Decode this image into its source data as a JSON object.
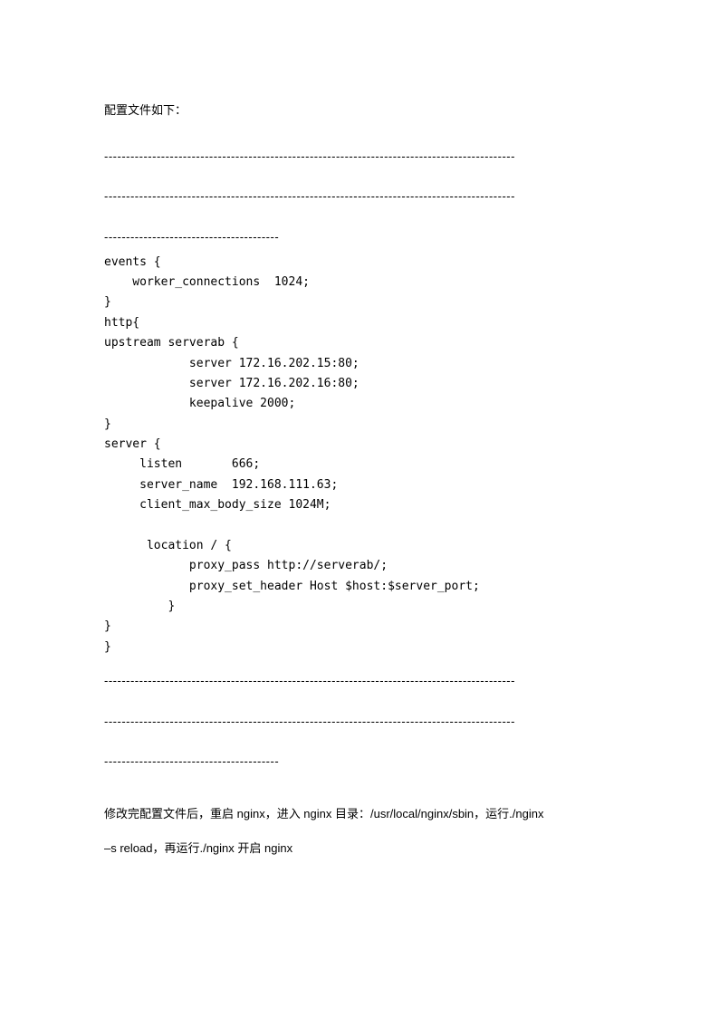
{
  "heading": "配置文件如下：",
  "divider_long": "----------------------------------------------------------------------------------------------",
  "divider_short": "----------------------------------------",
  "code_lines": [
    "events {",
    "    worker_connections  1024;",
    "}",
    "http{",
    "upstream serverab {",
    "            server 172.16.202.15:80;",
    "            server 172.16.202.16:80;",
    "            keepalive 2000;",
    "}",
    "server {",
    "     listen       666;",
    "     server_name  192.168.111.63;",
    "     client_max_body_size 1024M;",
    "",
    "      location / {",
    "            proxy_pass http://serverab/;",
    "            proxy_set_header Host $host:$server_port;",
    "         }",
    "}",
    "}"
  ],
  "footer_line1": "修改完配置文件后，重启 nginx，进入 nginx 目录：/usr/local/nginx/sbin，运行./nginx",
  "footer_line2": "–s reload，再运行./nginx 开启 nginx"
}
